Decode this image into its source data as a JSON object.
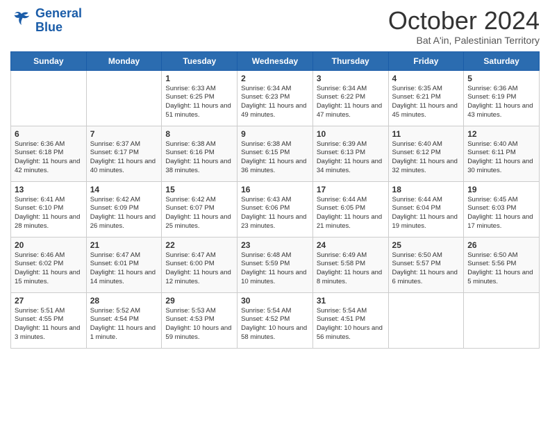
{
  "logo": {
    "line1": "General",
    "line2": "Blue"
  },
  "title": "October 2024",
  "location": "Bat A'in, Palestinian Territory",
  "days_of_week": [
    "Sunday",
    "Monday",
    "Tuesday",
    "Wednesday",
    "Thursday",
    "Friday",
    "Saturday"
  ],
  "weeks": [
    [
      {
        "day": "",
        "info": ""
      },
      {
        "day": "",
        "info": ""
      },
      {
        "day": "1",
        "info": "Sunrise: 6:33 AM\nSunset: 6:25 PM\nDaylight: 11 hours and 51 minutes."
      },
      {
        "day": "2",
        "info": "Sunrise: 6:34 AM\nSunset: 6:23 PM\nDaylight: 11 hours and 49 minutes."
      },
      {
        "day": "3",
        "info": "Sunrise: 6:34 AM\nSunset: 6:22 PM\nDaylight: 11 hours and 47 minutes."
      },
      {
        "day": "4",
        "info": "Sunrise: 6:35 AM\nSunset: 6:21 PM\nDaylight: 11 hours and 45 minutes."
      },
      {
        "day": "5",
        "info": "Sunrise: 6:36 AM\nSunset: 6:19 PM\nDaylight: 11 hours and 43 minutes."
      }
    ],
    [
      {
        "day": "6",
        "info": "Sunrise: 6:36 AM\nSunset: 6:18 PM\nDaylight: 11 hours and 42 minutes."
      },
      {
        "day": "7",
        "info": "Sunrise: 6:37 AM\nSunset: 6:17 PM\nDaylight: 11 hours and 40 minutes."
      },
      {
        "day": "8",
        "info": "Sunrise: 6:38 AM\nSunset: 6:16 PM\nDaylight: 11 hours and 38 minutes."
      },
      {
        "day": "9",
        "info": "Sunrise: 6:38 AM\nSunset: 6:15 PM\nDaylight: 11 hours and 36 minutes."
      },
      {
        "day": "10",
        "info": "Sunrise: 6:39 AM\nSunset: 6:13 PM\nDaylight: 11 hours and 34 minutes."
      },
      {
        "day": "11",
        "info": "Sunrise: 6:40 AM\nSunset: 6:12 PM\nDaylight: 11 hours and 32 minutes."
      },
      {
        "day": "12",
        "info": "Sunrise: 6:40 AM\nSunset: 6:11 PM\nDaylight: 11 hours and 30 minutes."
      }
    ],
    [
      {
        "day": "13",
        "info": "Sunrise: 6:41 AM\nSunset: 6:10 PM\nDaylight: 11 hours and 28 minutes."
      },
      {
        "day": "14",
        "info": "Sunrise: 6:42 AM\nSunset: 6:09 PM\nDaylight: 11 hours and 26 minutes."
      },
      {
        "day": "15",
        "info": "Sunrise: 6:42 AM\nSunset: 6:07 PM\nDaylight: 11 hours and 25 minutes."
      },
      {
        "day": "16",
        "info": "Sunrise: 6:43 AM\nSunset: 6:06 PM\nDaylight: 11 hours and 23 minutes."
      },
      {
        "day": "17",
        "info": "Sunrise: 6:44 AM\nSunset: 6:05 PM\nDaylight: 11 hours and 21 minutes."
      },
      {
        "day": "18",
        "info": "Sunrise: 6:44 AM\nSunset: 6:04 PM\nDaylight: 11 hours and 19 minutes."
      },
      {
        "day": "19",
        "info": "Sunrise: 6:45 AM\nSunset: 6:03 PM\nDaylight: 11 hours and 17 minutes."
      }
    ],
    [
      {
        "day": "20",
        "info": "Sunrise: 6:46 AM\nSunset: 6:02 PM\nDaylight: 11 hours and 15 minutes."
      },
      {
        "day": "21",
        "info": "Sunrise: 6:47 AM\nSunset: 6:01 PM\nDaylight: 11 hours and 14 minutes."
      },
      {
        "day": "22",
        "info": "Sunrise: 6:47 AM\nSunset: 6:00 PM\nDaylight: 11 hours and 12 minutes."
      },
      {
        "day": "23",
        "info": "Sunrise: 6:48 AM\nSunset: 5:59 PM\nDaylight: 11 hours and 10 minutes."
      },
      {
        "day": "24",
        "info": "Sunrise: 6:49 AM\nSunset: 5:58 PM\nDaylight: 11 hours and 8 minutes."
      },
      {
        "day": "25",
        "info": "Sunrise: 6:50 AM\nSunset: 5:57 PM\nDaylight: 11 hours and 6 minutes."
      },
      {
        "day": "26",
        "info": "Sunrise: 6:50 AM\nSunset: 5:56 PM\nDaylight: 11 hours and 5 minutes."
      }
    ],
    [
      {
        "day": "27",
        "info": "Sunrise: 5:51 AM\nSunset: 4:55 PM\nDaylight: 11 hours and 3 minutes."
      },
      {
        "day": "28",
        "info": "Sunrise: 5:52 AM\nSunset: 4:54 PM\nDaylight: 11 hours and 1 minute."
      },
      {
        "day": "29",
        "info": "Sunrise: 5:53 AM\nSunset: 4:53 PM\nDaylight: 10 hours and 59 minutes."
      },
      {
        "day": "30",
        "info": "Sunrise: 5:54 AM\nSunset: 4:52 PM\nDaylight: 10 hours and 58 minutes."
      },
      {
        "day": "31",
        "info": "Sunrise: 5:54 AM\nSunset: 4:51 PM\nDaylight: 10 hours and 56 minutes."
      },
      {
        "day": "",
        "info": ""
      },
      {
        "day": "",
        "info": ""
      }
    ]
  ]
}
